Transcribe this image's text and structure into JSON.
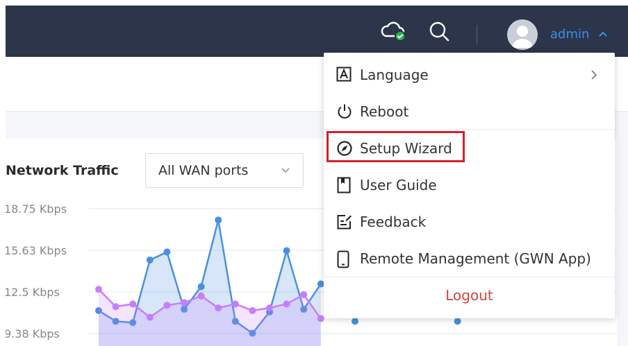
{
  "header": {
    "username": "admin",
    "icons": [
      "cloud-check-icon",
      "search-icon",
      "avatar-icon",
      "chevron-up-icon"
    ],
    "accent_color": "#3d8ef0",
    "background_color": "#2c3549"
  },
  "network_traffic": {
    "title": "Network Traffic",
    "wan_select": {
      "value": "All WAN ports"
    }
  },
  "chart_data": {
    "type": "area",
    "title": "Network Traffic",
    "y_ticks": [
      "18.75 Kbps",
      "15.63 Kbps",
      "12.5 Kbps",
      "9.38 Kbps"
    ],
    "ylim": [
      9.38,
      18.75
    ],
    "series": [
      {
        "color": "#4a90e2",
        "values": [
          11.1,
          10.3,
          10.2,
          14.9,
          15.5,
          11.2,
          12.9,
          17.9,
          10.3,
          9.4,
          11.0,
          15.6,
          11.2,
          13.1,
          null,
          10.3,
          null,
          null,
          null,
          null,
          null,
          10.3
        ]
      },
      {
        "color": "#c77dff",
        "values": [
          12.7,
          11.4,
          11.6,
          10.6,
          11.5,
          11.7,
          12.2,
          11.3,
          11.6,
          11.1,
          11.3,
          11.6,
          12.3,
          10.5
        ]
      }
    ],
    "grid": true
  },
  "menu": {
    "items": [
      {
        "label": "Language",
        "icon": "language-icon",
        "has_submenu": true
      },
      {
        "label": "Reboot",
        "icon": "power-icon"
      },
      {
        "label": "Setup Wizard",
        "icon": "compass-icon",
        "highlighted": true
      },
      {
        "label": "User Guide",
        "icon": "book-icon"
      },
      {
        "label": "Feedback",
        "icon": "feedback-icon"
      },
      {
        "label": "Remote Management (GWN App)",
        "icon": "phone-icon"
      }
    ],
    "logout_label": "Logout",
    "logout_color": "#d9443a",
    "highlight_color": "#d71f2a"
  }
}
